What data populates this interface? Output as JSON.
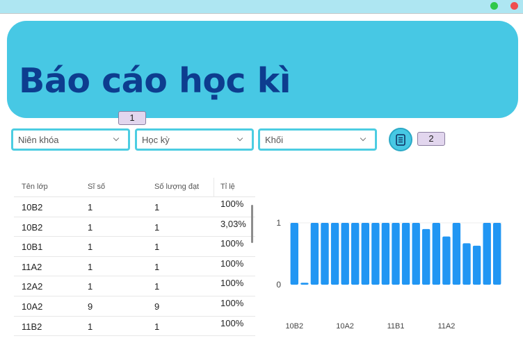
{
  "header": {
    "title": "Báo cáo học kì"
  },
  "annotations": {
    "tag1": "1",
    "tag2": "2"
  },
  "filters": {
    "nien_khoa": "Niên khóa",
    "hoc_ky": "Học kỳ",
    "khoi": "Khối"
  },
  "table": {
    "headers": [
      "Tên lớp",
      "Sĩ số",
      "Số lượng đạt",
      "Tỉ lệ"
    ],
    "rows": [
      [
        "10B2",
        "1",
        "1",
        "100%"
      ],
      [
        "10B2",
        "1",
        "1",
        "3,03%"
      ],
      [
        "10B1",
        "1",
        "1",
        "100%"
      ],
      [
        "11A2",
        "1",
        "1",
        "100%"
      ],
      [
        "12A2",
        "1",
        "1",
        "100%"
      ],
      [
        "10A2",
        "9",
        "9",
        "100%"
      ],
      [
        "11B2",
        "1",
        "1",
        "100%"
      ]
    ]
  },
  "colors": {
    "banner": "#47c8e4",
    "title": "#0d3d8f",
    "bar": "#2196f3",
    "select_border": "#4ccde2"
  },
  "chart_data": {
    "type": "bar",
    "ylim": [
      0,
      1
    ],
    "yticks": [
      "0",
      "1"
    ],
    "xtick_labels": [
      "10B2",
      "10A2",
      "11B1",
      "11A2"
    ],
    "xtick_positions": [
      0,
      5,
      10,
      15
    ],
    "values": [
      1,
      0.03,
      1,
      1,
      1,
      1,
      1,
      1,
      1,
      1,
      1,
      1,
      1,
      0.9,
      1,
      0.78,
      1,
      0.67,
      0.63,
      1,
      1
    ]
  }
}
